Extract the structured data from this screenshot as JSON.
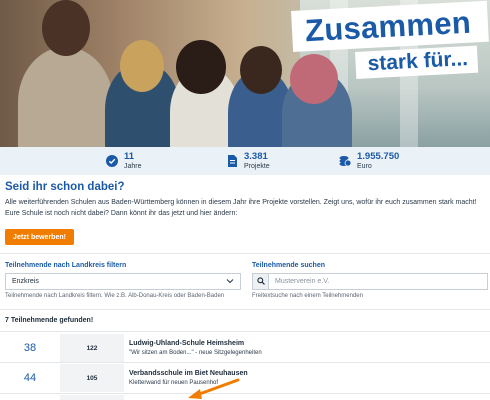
{
  "hero": {
    "banner_line1": "Zusammen",
    "banner_line2": "stark für..."
  },
  "stats": [
    {
      "value": "11",
      "label": "Jahre",
      "icon": "check-badge-icon"
    },
    {
      "value": "3.381",
      "label": "Projekte",
      "icon": "document-icon"
    },
    {
      "value": "1.955.750",
      "label": "Euro",
      "icon": "coins-icon"
    }
  ],
  "intro": {
    "heading": "Seid ihr schon dabei?",
    "text": "Alle weiterführenden Schulen aus Baden-Württemberg können in diesem Jahr ihre Projekte vorstellen. Zeigt uns, wofür ihr euch zusammen stark macht! Eure Schule ist noch nicht dabei? Dann könnt ihr das jetzt und hier ändern:",
    "apply_button": "Jetzt bewerben!"
  },
  "filter": {
    "label": "Teilnehmende nach Landkreis filtern",
    "selected": "Enzkreis",
    "hint": "Teilnehmende nach Landkreis filtern. Wie z.B. Alb-Donau-Kreis oder Baden-Baden"
  },
  "search": {
    "label": "Teilnehmende suchen",
    "placeholder": "Musterverein e.V.",
    "hint": "Freitextsuche nach einem Teilnehmenden"
  },
  "results": {
    "count_text": "7 Teilnehmende gefunden!",
    "items": [
      {
        "rank": "38",
        "votes": "122",
        "name": "Ludwig-Uhland-Schule Heimsheim",
        "subtitle": "\"Wir sitzen am Boden...\" - neue Sitzgelegenheiten"
      },
      {
        "rank": "44",
        "votes": "105",
        "name": "Verbandsschule im Biet Neuhausen",
        "subtitle": "Kletterwand für neuen Pausenhof"
      }
    ]
  },
  "colors": {
    "brand_blue": "#1b5aa6",
    "accent_orange": "#f07d00",
    "stats_bg": "#eaf1f7"
  }
}
